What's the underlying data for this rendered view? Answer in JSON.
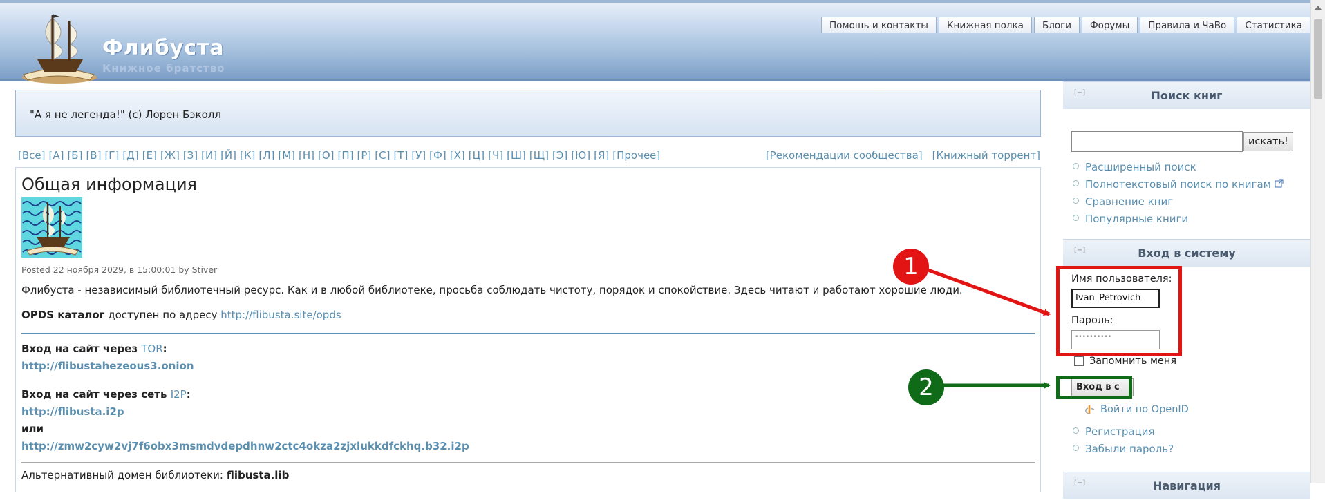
{
  "header": {
    "title": "Флибуста",
    "subtitle": "Книжное братство",
    "tabs": [
      "Помощь и контакты",
      "Книжная полка",
      "Блоги",
      "Форумы",
      "Правила и ЧаВо",
      "Статистика"
    ]
  },
  "quote": "\"А я не легенда!\" (c) Лорен Бэколл",
  "alphabet": [
    "[Все]",
    "[А]",
    "[Б]",
    "[В]",
    "[Г]",
    "[Д]",
    "[Е]",
    "[Ж]",
    "[З]",
    "[И]",
    "[Й]",
    "[К]",
    "[Л]",
    "[М]",
    "[Н]",
    "[О]",
    "[П]",
    "[Р]",
    "[С]",
    "[Т]",
    "[У]",
    "[Ф]",
    "[Х]",
    "[Ц]",
    "[Ч]",
    "[Ш]",
    "[Щ]",
    "[Э]",
    "[Ю]",
    "[Я]",
    "[Прочее]"
  ],
  "alpha_right": [
    "[Рекомендации сообщества]",
    "[Книжный торрент]"
  ],
  "article": {
    "heading": "Общая информация",
    "posted": "Posted 22 ноября 2029, в 15:00:01 by Stiver",
    "intro": "Флибуста - независимый библиотечный ресурс. Как и в любой библиотеке, просьба соблюдать чистоту, порядок и спокойствие. Здесь читают и работают хорошие люди.",
    "opds_label": "OPDS каталог",
    "opds_text": " доступен по адресу ",
    "opds_link": "http://flibusta.site/opds",
    "tor_label": "Вход на сайт через ",
    "tor_link_word": "TOR",
    "tor_url": "http://flibustahezeous3.onion",
    "i2p_label": "Вход на сайт через сеть ",
    "i2p_link_word": "I2P",
    "i2p_url": "http://flibusta.i2p",
    "or": "или",
    "i2p_url2": "http://zmw2cyw2vj7f6obx3msmdvdepdhnw2ctc4okza2zjxlukkdfckhq.b32.i2p",
    "alt_domain_label": "Альтернативный домен библиотеки: ",
    "alt_domain": "flibusta.lib"
  },
  "sidebar": {
    "search_heading": "Поиск книг",
    "collapse": "[−]",
    "search_button": "искать!",
    "search_links": [
      "Расширенный поиск",
      "Полнотекстовый поиск по книгам",
      "Сравнение книг",
      "Популярные книги"
    ],
    "login_heading": "Вход в систему",
    "username_label": "Имя пользователя:",
    "username_value": "Ivan_Petrovich",
    "password_label": "Пароль:",
    "password_value": "••••••••••",
    "remember_label": "Запомнить меня",
    "login_button": "Вход в с",
    "openid_label": "Войти по OpenID",
    "account_links": [
      "Регистрация",
      "Забыли пароль?"
    ],
    "nav_heading": "Навигация"
  },
  "annotations": {
    "step1": "1",
    "step2": "2",
    "red": "#e31414",
    "green": "#0f6b17"
  }
}
